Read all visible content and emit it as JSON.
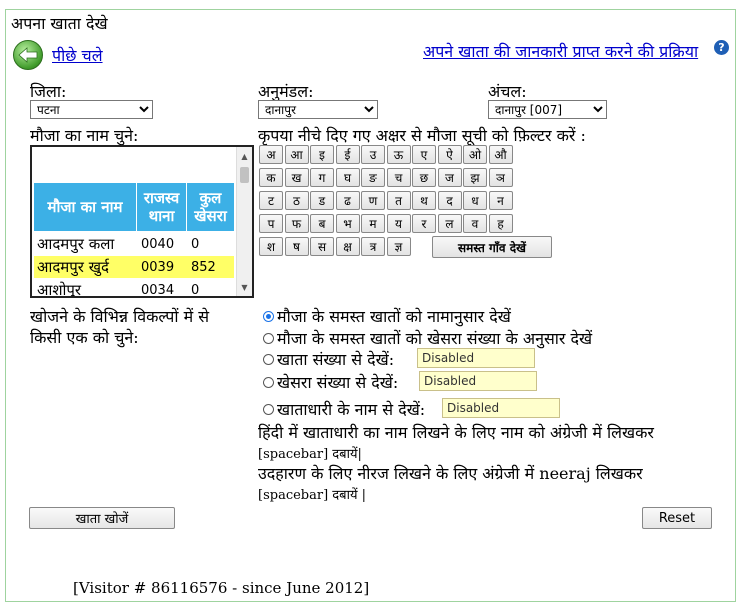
{
  "page_title": "अपना खाता देखे",
  "back_link": "पीछे चले",
  "process_link": "अपने खाता की जानकारी प्राप्त करने की प्रक्रिया",
  "help_icon": "?",
  "district": {
    "label": "जिला:",
    "value": "पटना"
  },
  "subdivision": {
    "label": "अनुमंडल:",
    "value": "दानापुर"
  },
  "circle": {
    "label": "अंचल:",
    "value": "दानापुर [007]"
  },
  "mouza_label": "मौजा का नाम चुने:",
  "filter_label": "कृपया नीचे दिए गए अक्षर से मौजा सूची को फ़िल्टर करें :",
  "mouza_table": {
    "headers": [
      "मौजा का नाम",
      "राजस्व थाना",
      "कुल खेसरा"
    ],
    "rows": [
      {
        "name": "आदमपुर कला",
        "thana": "0040",
        "khesra": "0",
        "selected": false
      },
      {
        "name": "आदमपुर खुर्द",
        "thana": "0039",
        "khesra": "852",
        "selected": true
      },
      {
        "name": "आशोपुर",
        "thana": "0034",
        "khesra": "0",
        "selected": false
      }
    ]
  },
  "letters": {
    "row1": [
      "अ",
      "आ",
      "इ",
      "ई",
      "उ",
      "ऊ",
      "ए",
      "ऐ",
      "ओ",
      "औ"
    ],
    "row2": [
      "क",
      "ख",
      "ग",
      "घ",
      "ङ",
      "च",
      "छ",
      "ज",
      "झ",
      "ञ"
    ],
    "row3": [
      "ट",
      "ठ",
      "ड",
      "ढ",
      "ण",
      "त",
      "थ",
      "द",
      "ध",
      "न"
    ],
    "row4": [
      "प",
      "फ",
      "ब",
      "भ",
      "म",
      "य",
      "र",
      "ल",
      "व",
      "ह"
    ],
    "row5": [
      "श",
      "ष",
      "स",
      "क्ष",
      "त्र",
      "ज्ञ"
    ],
    "all_villages": "समस्त गाँव देखें"
  },
  "search_options_label_1": "खोजने के विभिन्न विकल्पों में से",
  "search_options_label_2": "किसी एक को चुने:",
  "options": {
    "by_name": "मौजा के समस्त खातों को नामानुसार देखें",
    "by_khesra": "मौजा के समस्त खातों को खेसरा संख्या के अनुसार देखें",
    "khata_no": "खाता संख्या से देखें:",
    "khesra_no": "खेसरा संख्या से देखें:",
    "holder_name": "खाताधारी के नाम से देखें:"
  },
  "disabled_text": "Disabled",
  "hint_1a": "हिंदी में खाताधारी का नाम लिखने के लिए नाम को अंग्रेजी में लिखकर",
  "hint_1b": "[spacebar] दबायें|",
  "hint_2a": "उदहारण के लिए नीरज लिखने के लिए अंग्रेजी में neeraj लिखकर",
  "hint_2b": "[spacebar] दबायें |",
  "search_button": "खाता खोजें",
  "reset_button": "Reset",
  "visitor_text": "[Visitor #  86116576 - since June 2012]"
}
